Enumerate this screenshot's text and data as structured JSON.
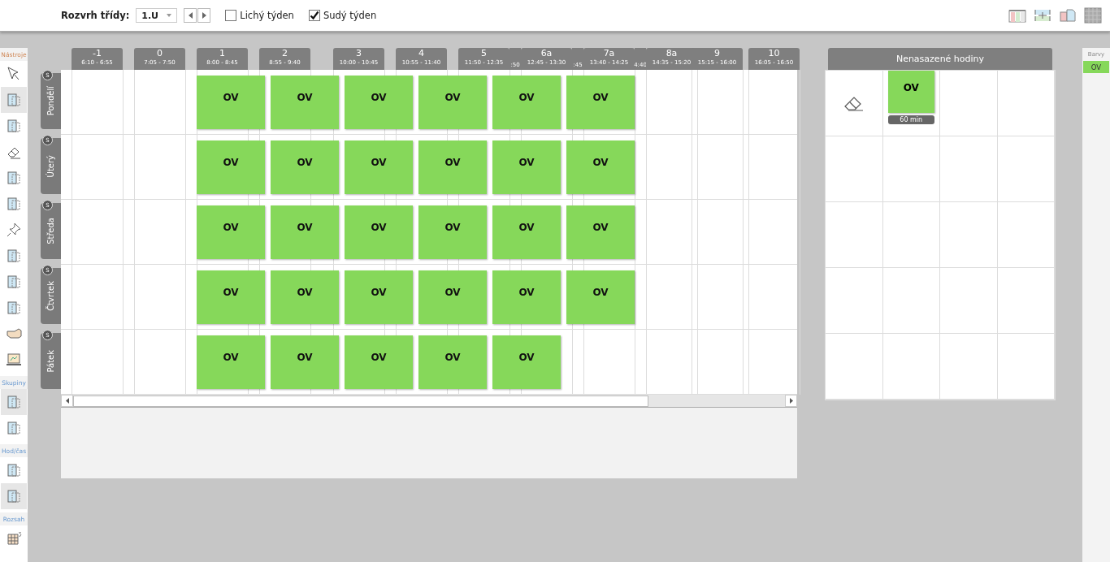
{
  "toolbar": {
    "class_label": "Rozvrh třídy:",
    "class_select": {
      "value": "1.U"
    },
    "week_options": [
      {
        "label": "Lichý týden",
        "checked": false
      },
      {
        "label": "Sudý týden",
        "checked": true
      }
    ]
  },
  "tool_panel": {
    "sections": [
      {
        "title": "Nástroje",
        "tools": [
          {
            "selected": false
          },
          {
            "selected": true
          },
          {
            "selected": false
          },
          {
            "selected": false
          },
          {
            "selected": false
          },
          {
            "selected": false
          },
          {
            "selected": false
          },
          {
            "selected": false
          },
          {
            "selected": false
          },
          {
            "selected": false
          },
          {
            "selected": false
          },
          {
            "selected": false
          }
        ]
      },
      {
        "title": "Skupiny",
        "tools": [
          {
            "selected": true
          },
          {
            "selected": false
          }
        ]
      },
      {
        "title": "Hod/čas",
        "tools": [
          {
            "selected": false
          },
          {
            "selected": true
          }
        ]
      },
      {
        "title": "Rozsah",
        "tools": [
          {
            "selected": false
          }
        ]
      }
    ]
  },
  "timetable": {
    "periods": [
      {
        "kind": "period",
        "number": "-1",
        "time": "6:10 - 6:55"
      },
      {
        "kind": "period",
        "number": "0",
        "time": "7:05 - 7:50"
      },
      {
        "kind": "period",
        "number": "1",
        "time": "8:00 - 8:45"
      },
      {
        "kind": "period",
        "number": "2",
        "time": "8:55 - 9:40"
      },
      {
        "kind": "period",
        "number": "3",
        "time": "10:00 - 10:45"
      },
      {
        "kind": "period",
        "number": "4",
        "time": "10:55 - 11:40"
      },
      {
        "kind": "period",
        "number": "5",
        "time": "11:50 - 12:35"
      },
      {
        "kind": "fragment",
        "text": ":50"
      },
      {
        "kind": "period",
        "number": "6a",
        "time": "12:45 - 13:30"
      },
      {
        "kind": "fragment",
        "text": ":45"
      },
      {
        "kind": "period",
        "number": "7a",
        "time": "13:40 - 14:25"
      },
      {
        "kind": "fragment",
        "text": "4:40"
      },
      {
        "kind": "period",
        "number": "8a",
        "time": "14:35 - 15:20"
      },
      {
        "kind": "period",
        "number": "9",
        "time": "15:15 - 16:00"
      },
      {
        "kind": "period",
        "number": "10",
        "time": "16:05 - 16:50"
      }
    ],
    "days": [
      {
        "name": "Pondělí",
        "badge": "S",
        "lessons": [
          {
            "subject": "OV",
            "color": "#86d85a"
          },
          {
            "subject": "OV",
            "color": "#86d85a"
          },
          {
            "subject": "OV",
            "color": "#86d85a"
          },
          {
            "subject": "OV",
            "color": "#86d85a"
          },
          {
            "subject": "OV",
            "color": "#86d85a"
          },
          {
            "subject": "OV",
            "color": "#86d85a"
          }
        ]
      },
      {
        "name": "Úterý",
        "badge": "S",
        "lessons": [
          {
            "subject": "OV",
            "color": "#86d85a"
          },
          {
            "subject": "OV",
            "color": "#86d85a"
          },
          {
            "subject": "OV",
            "color": "#86d85a"
          },
          {
            "subject": "OV",
            "color": "#86d85a"
          },
          {
            "subject": "OV",
            "color": "#86d85a"
          },
          {
            "subject": "OV",
            "color": "#86d85a"
          }
        ]
      },
      {
        "name": "Středa",
        "badge": "S",
        "lessons": [
          {
            "subject": "OV",
            "color": "#86d85a"
          },
          {
            "subject": "OV",
            "color": "#86d85a"
          },
          {
            "subject": "OV",
            "color": "#86d85a"
          },
          {
            "subject": "OV",
            "color": "#86d85a"
          },
          {
            "subject": "OV",
            "color": "#86d85a"
          },
          {
            "subject": "OV",
            "color": "#86d85a"
          }
        ]
      },
      {
        "name": "Čtvrtek",
        "badge": "S",
        "lessons": [
          {
            "subject": "OV",
            "color": "#86d85a"
          },
          {
            "subject": "OV",
            "color": "#86d85a"
          },
          {
            "subject": "OV",
            "color": "#86d85a"
          },
          {
            "subject": "OV",
            "color": "#86d85a"
          },
          {
            "subject": "OV",
            "color": "#86d85a"
          },
          {
            "subject": "OV",
            "color": "#86d85a"
          }
        ]
      },
      {
        "name": "Pátek",
        "badge": "S",
        "lessons": [
          {
            "subject": "OV",
            "color": "#86d85a"
          },
          {
            "subject": "OV",
            "color": "#86d85a"
          },
          {
            "subject": "OV",
            "color": "#86d85a"
          },
          {
            "subject": "OV",
            "color": "#86d85a"
          },
          {
            "subject": "OV",
            "color": "#86d85a"
          }
        ]
      }
    ]
  },
  "unplaced": {
    "title": "Nenasazené hodiny",
    "lessons": [
      {
        "subject": "OV",
        "duration": "60 min",
        "color": "#86d85a"
      }
    ]
  },
  "colors": {
    "title": "Barvy",
    "items": [
      {
        "label": "OV",
        "color": "#86d85a"
      }
    ]
  }
}
